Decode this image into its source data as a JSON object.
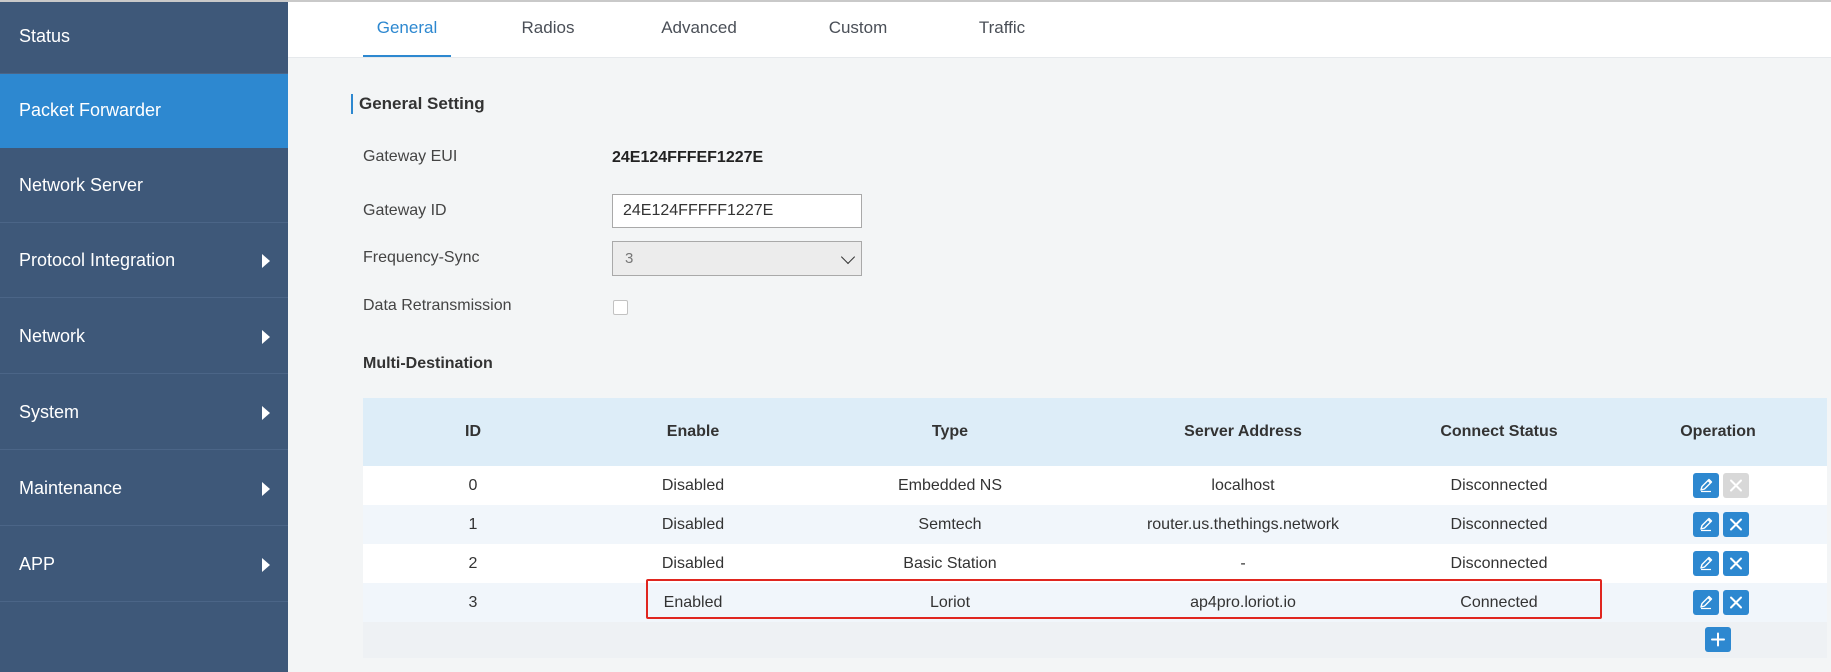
{
  "sidebar": {
    "items": [
      {
        "label": "Status",
        "has_submenu": false,
        "active": false
      },
      {
        "label": "Packet Forwarder",
        "has_submenu": false,
        "active": true
      },
      {
        "label": "Network Server",
        "has_submenu": false,
        "active": false
      },
      {
        "label": "Protocol Integration",
        "has_submenu": true,
        "active": false
      },
      {
        "label": "Network",
        "has_submenu": true,
        "active": false
      },
      {
        "label": "System",
        "has_submenu": true,
        "active": false
      },
      {
        "label": "Maintenance",
        "has_submenu": true,
        "active": false
      },
      {
        "label": "APP",
        "has_submenu": true,
        "active": false
      }
    ]
  },
  "tabs": [
    {
      "label": "General",
      "active": true
    },
    {
      "label": "Radios",
      "active": false
    },
    {
      "label": "Advanced",
      "active": false
    },
    {
      "label": "Custom",
      "active": false
    },
    {
      "label": "Traffic",
      "active": false
    }
  ],
  "general": {
    "section_title": "General Setting",
    "gateway_eui_label": "Gateway EUI",
    "gateway_eui_value": "24E124FFFEF1227E",
    "gateway_id_label": "Gateway ID",
    "gateway_id_value": "24E124FFFFF1227E",
    "frequency_sync_label": "Frequency-Sync",
    "frequency_sync_value": "3",
    "data_retransmission_label": "Data Retransmission",
    "data_retransmission_checked": false
  },
  "multi_destination": {
    "title": "Multi-Destination",
    "headers": {
      "id": "ID",
      "enable": "Enable",
      "type": "Type",
      "server_address": "Server Address",
      "connect_status": "Connect Status",
      "operation": "Operation"
    },
    "rows": [
      {
        "id": "0",
        "enable": "Disabled",
        "type": "Embedded NS",
        "server_address": "localhost",
        "connect_status": "Disconnected",
        "delete_enabled": false
      },
      {
        "id": "1",
        "enable": "Disabled",
        "type": "Semtech",
        "server_address": "router.us.thethings.network",
        "connect_status": "Disconnected",
        "delete_enabled": true
      },
      {
        "id": "2",
        "enable": "Disabled",
        "type": "Basic Station",
        "server_address": "-",
        "connect_status": "Disconnected",
        "delete_enabled": true
      },
      {
        "id": "3",
        "enable": "Enabled",
        "type": "Loriot",
        "server_address": "ap4pro.loriot.io",
        "connect_status": "Connected",
        "delete_enabled": true
      }
    ]
  },
  "colors": {
    "sidebar_bg": "#3e5879",
    "accent": "#2d88d0",
    "highlight_border": "#e0261f"
  }
}
